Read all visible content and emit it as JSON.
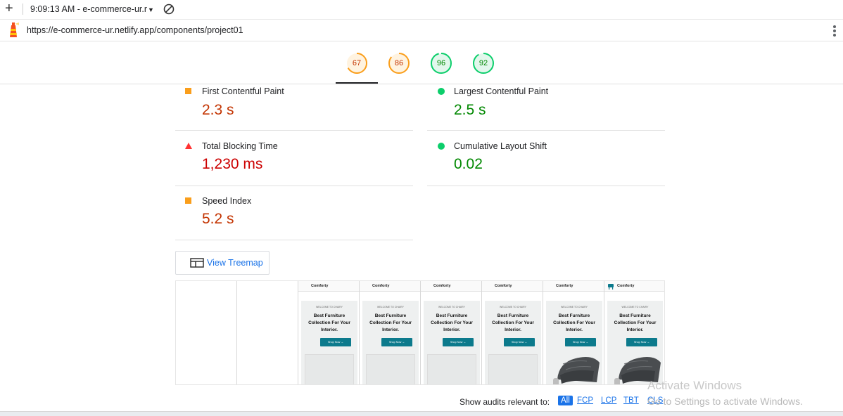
{
  "toolbar": {
    "plus_icon": "plus-icon",
    "session_label": "9:09:13 AM - e-commerce-ur.r",
    "clear_icon": "no-entry-icon"
  },
  "address": {
    "icon": "lighthouse-icon",
    "url": "https://e-commerce-ur.netlify.app/components/project01",
    "menu_icon": "kebab-icon"
  },
  "gauges": [
    {
      "score": "67",
      "category": "performance",
      "status": "average",
      "color": "#fa9e1b",
      "text_color": "#c33300",
      "fraction": 0.67
    },
    {
      "score": "86",
      "category": "accessibility",
      "status": "average",
      "color": "#fa9e1b",
      "text_color": "#c33300",
      "fraction": 0.86
    },
    {
      "score": "96",
      "category": "best-practices",
      "status": "pass",
      "color": "#0cce6b",
      "text_color": "#008800",
      "fraction": 0.96
    },
    {
      "score": "92",
      "category": "seo",
      "status": "pass",
      "color": "#0cce6b",
      "text_color": "#008800",
      "fraction": 0.92
    }
  ],
  "metrics": [
    {
      "label": "First Contentful Paint",
      "value": "2.3 s",
      "status": "average",
      "icon": "orange-square-icon",
      "value_color": "#c33300"
    },
    {
      "label": "Largest Contentful Paint",
      "value": "2.5 s",
      "status": "pass",
      "icon": "green-circle-icon",
      "value_color": "#008800"
    },
    {
      "label": "Total Blocking Time",
      "value": "1,230 ms",
      "status": "fail",
      "icon": "red-triangle-icon",
      "value_color": "#cc0000"
    },
    {
      "label": "Cumulative Layout Shift",
      "value": "0.02",
      "status": "pass",
      "icon": "green-circle-icon",
      "value_color": "#008800"
    },
    {
      "label": "Speed Index",
      "value": "5.2 s",
      "status": "average",
      "icon": "orange-square-icon",
      "value_color": "#c33300"
    }
  ],
  "treemap": {
    "label": "View Treemap",
    "icon": "treemap-icon"
  },
  "filmstrip": {
    "frames": [
      {
        "blank": true
      },
      {
        "blank": true
      },
      {
        "blank": false,
        "brand": "Comforty",
        "welcome": "WELCOME TO CHAIRY",
        "title": "Best Furniture Collection For Your Interior.",
        "button": "Shop Now  →",
        "photo": false,
        "logo": false
      },
      {
        "blank": false,
        "brand": "Comforty",
        "welcome": "WELCOME TO CHAIRY",
        "title": "Best Furniture Collection For Your Interior.",
        "button": "Shop Now  →",
        "photo": false,
        "logo": false
      },
      {
        "blank": false,
        "brand": "Comforty",
        "welcome": "WELCOME TO CHAIRY",
        "title": "Best Furniture Collection For Your Interior.",
        "button": "Shop Now  →",
        "photo": false,
        "logo": false
      },
      {
        "blank": false,
        "brand": "Comforty",
        "welcome": "WELCOME TO CHAIRY",
        "title": "Best Furniture Collection For Your Interior.",
        "button": "Shop Now  →",
        "photo": false,
        "logo": false
      },
      {
        "blank": false,
        "brand": "Comforty",
        "welcome": "WELCOME TO CHAIRY",
        "title": "Best Furniture Collection For Your Interior.",
        "button": "Shop Now  →",
        "photo": true,
        "logo": false
      },
      {
        "blank": false,
        "brand": "Comforty",
        "welcome": "WELCOME TO CHAIRY",
        "title": "Best Furniture Collection For Your Interior.",
        "button": "Shop Now  →",
        "photo": true,
        "logo": true
      }
    ]
  },
  "audit_filter": {
    "label": "Show audits relevant to:",
    "chips": [
      {
        "label": "All",
        "active": true
      },
      {
        "label": "FCP",
        "active": false
      },
      {
        "label": "LCP",
        "active": false
      },
      {
        "label": "TBT",
        "active": false
      },
      {
        "label": "CLS",
        "active": false
      }
    ]
  },
  "watermark": {
    "line1": "Activate Windows",
    "line2": "Go to Settings to activate Windows."
  }
}
